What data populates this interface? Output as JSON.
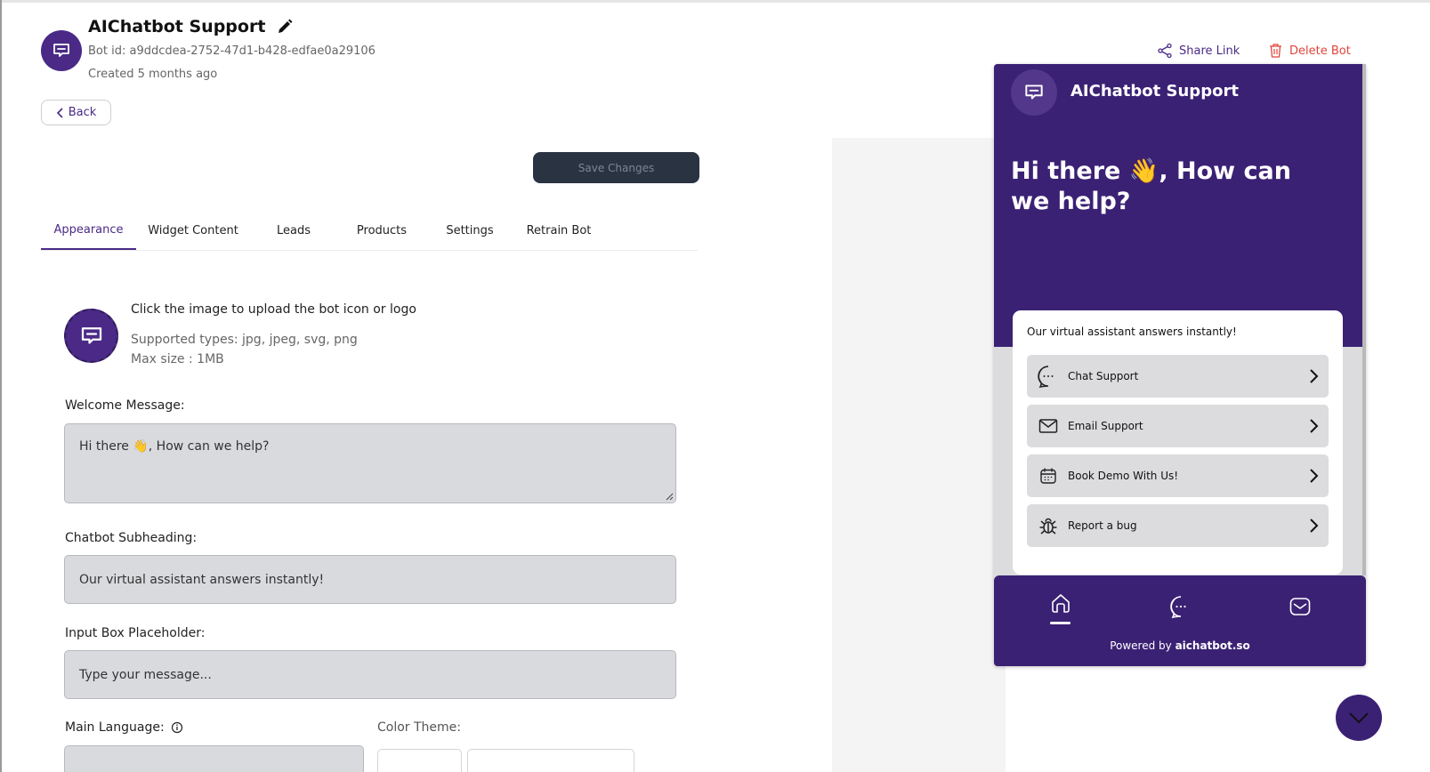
{
  "bot": {
    "name": "AIChatbot Support",
    "id_text": "Bot id: a9ddcdea-2752-47d1-b428-edfae0a29106",
    "created": "Created 5 months ago"
  },
  "actions": {
    "back": "Back",
    "save": "Save Changes",
    "share": "Share Link",
    "delete": "Delete Bot"
  },
  "tabs": [
    {
      "label": "Appearance",
      "active": true
    },
    {
      "label": "Widget Content"
    },
    {
      "label": "Leads"
    },
    {
      "label": "Products"
    },
    {
      "label": "Settings"
    },
    {
      "label": "Retrain Bot"
    }
  ],
  "upload": {
    "title": "Click the image to upload the bot icon or logo",
    "types": "Supported types: jpg, jpeg, svg, png",
    "size": "Max size : 1MB"
  },
  "form": {
    "welcome_label": "Welcome Message:",
    "welcome_value": "Hi there 👋, How can we help?",
    "subheading_label": "Chatbot Subheading:",
    "subheading_value": "Our virtual assistant answers instantly!",
    "placeholder_label": "Input Box Placeholder:",
    "placeholder_value": "Type your message...",
    "language_label": "Main Language:",
    "theme_label": "Color Theme:"
  },
  "widget": {
    "title": "AIChatbot Support",
    "welcome": "Hi there 👋, How can we help?",
    "subheading": "Our virtual assistant answers instantly!",
    "options": [
      {
        "label": "Chat Support",
        "icon": "chat-bubble-icon"
      },
      {
        "label": "Email Support",
        "icon": "envelope-icon"
      },
      {
        "label": "Book Demo With Us!",
        "icon": "calendar-icon"
      },
      {
        "label": "Report a bug",
        "icon": "bug-icon"
      }
    ],
    "powered_prefix": "Powered by",
    "powered_brand": "aichatbot.so"
  },
  "colors": {
    "brand": "#3b2174",
    "accent": "#4a2a86",
    "danger": "#e0453a"
  }
}
